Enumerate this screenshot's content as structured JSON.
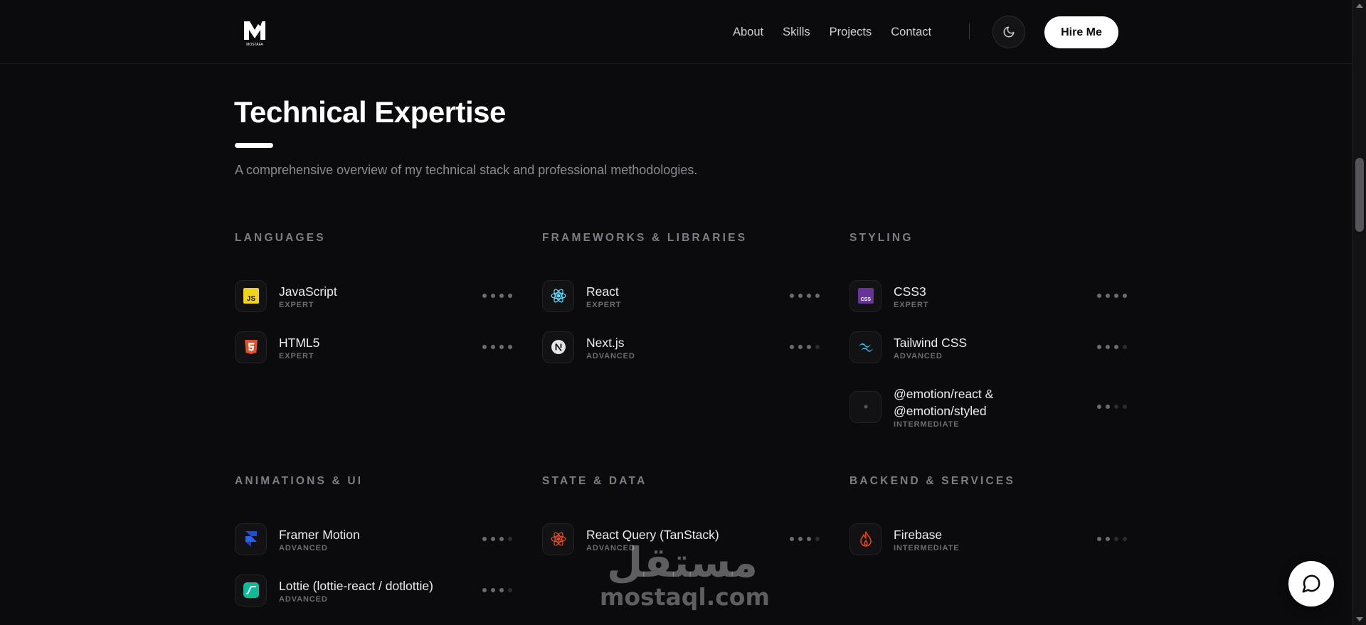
{
  "header": {
    "logo_caption": "MOSTAFA",
    "nav": [
      "About",
      "Skills",
      "Projects",
      "Contact"
    ],
    "hire_label": "Hire Me",
    "theme_icon": "moon-icon"
  },
  "section": {
    "title": "Technical Expertise",
    "subtitle": "A comprehensive overview of my technical stack and professional methodologies."
  },
  "categories": [
    {
      "title": "Languages",
      "skills": [
        {
          "name": "JavaScript",
          "level": "Expert",
          "dots": 4,
          "icon": "javascript-icon",
          "color": "#f0d21b"
        },
        {
          "name": "HTML5",
          "level": "Expert",
          "dots": 4,
          "icon": "html5-icon",
          "color": "#e0502a"
        }
      ]
    },
    {
      "title": "Frameworks & Libraries",
      "skills": [
        {
          "name": "React",
          "level": "Expert",
          "dots": 4,
          "icon": "react-icon",
          "color": "#61dafb"
        },
        {
          "name": "Next.js",
          "level": "Advanced",
          "dots": 3,
          "icon": "nextjs-icon",
          "color": "#ffffff"
        }
      ]
    },
    {
      "title": "Styling",
      "skills": [
        {
          "name": "CSS3",
          "level": "Expert",
          "dots": 4,
          "icon": "css3-icon",
          "color": "#663399"
        },
        {
          "name": "Tailwind CSS",
          "level": "Advanced",
          "dots": 3,
          "icon": "tailwind-icon",
          "color": "#38bdf8"
        },
        {
          "name_lines": [
            "@emotion/react &",
            "@emotion/styled"
          ],
          "level": "Intermediate",
          "dots": 2,
          "icon": "emotion-icon",
          "color": "#555555"
        }
      ]
    },
    {
      "title": "Animations & UI",
      "skills": [
        {
          "name": "Framer Motion",
          "level": "Advanced",
          "dots": 3,
          "icon": "framer-motion-icon",
          "color": "#1d4ed8"
        },
        {
          "name": "Lottie (lottie-react / dotlottie)",
          "level": "Advanced",
          "dots": 3,
          "icon": "lottie-icon",
          "color": "#10b99a"
        }
      ]
    },
    {
      "title": "State & Data",
      "skills": [
        {
          "name": "React Query (TanStack)",
          "level": "Advanced",
          "dots": 3,
          "icon": "react-query-icon",
          "color": "#e14c2a"
        }
      ]
    },
    {
      "title": "Backend & Services",
      "skills": [
        {
          "name": "Firebase",
          "level": "Intermediate",
          "dots": 2,
          "icon": "firebase-icon",
          "color": "#e8401f"
        }
      ]
    }
  ],
  "watermark": {
    "arabic": "مستقل",
    "latin": "mostaql.com"
  },
  "chat_icon": "chat-bubble-icon"
}
